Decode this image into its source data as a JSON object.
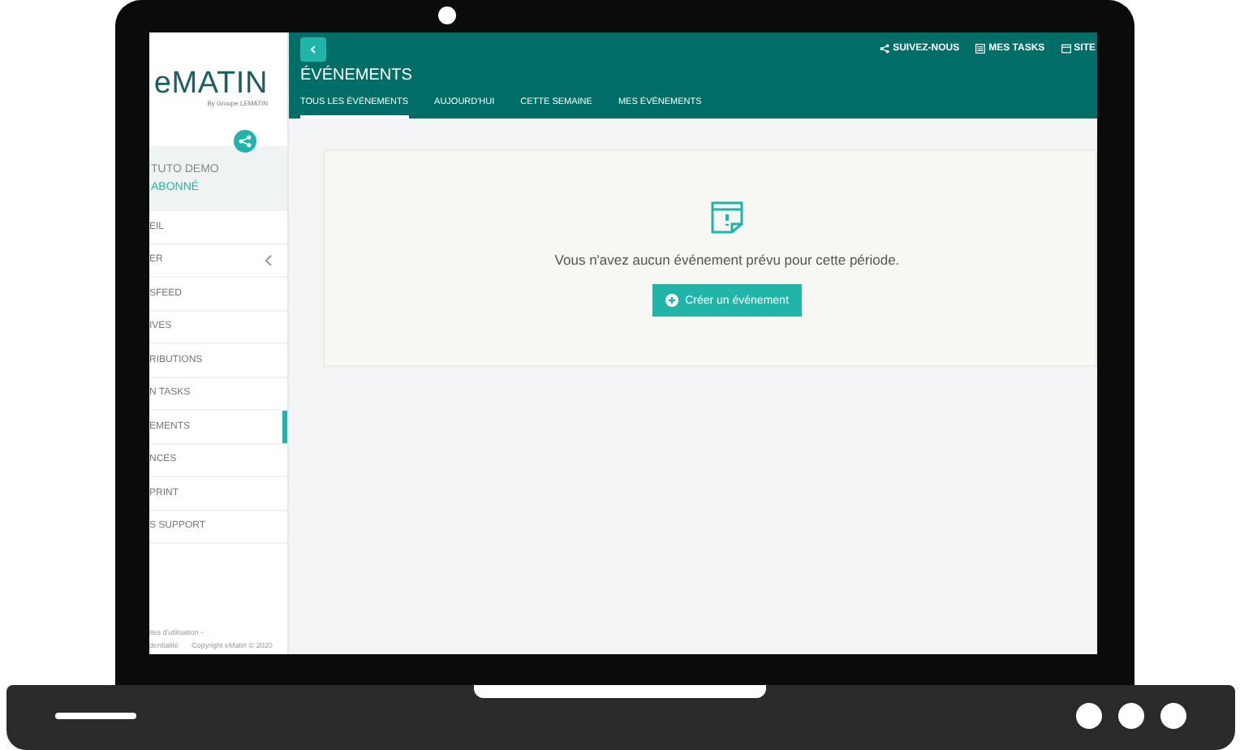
{
  "sidebar": {
    "logo": "eMATIN",
    "logo_subtitle": "By Groupe LEMATIN",
    "user_name": "TUTO DEMO",
    "user_status": "ABONNÉ",
    "items": [
      {
        "label": "EIL",
        "selected": false,
        "expandable": false
      },
      {
        "label": "ER",
        "selected": false,
        "expandable": true
      },
      {
        "label": "SFEED",
        "selected": false,
        "expandable": false
      },
      {
        "label": "IVES",
        "selected": false,
        "expandable": false
      },
      {
        "label": "RIBUTIONS",
        "selected": false,
        "expandable": false
      },
      {
        "label": "N TASKS",
        "selected": false,
        "expandable": false
      },
      {
        "label": "EMENTS",
        "selected": true,
        "expandable": false
      },
      {
        "label": "NCES",
        "selected": false,
        "expandable": false
      },
      {
        "label": "PRINT",
        "selected": false,
        "expandable": false
      },
      {
        "label": "S SUPPORT",
        "selected": false,
        "expandable": false
      }
    ],
    "footer_line_1": "ites d'utilisation -",
    "footer_line_2": "dentialité",
    "copyright": "Copyright eMatin © 2020"
  },
  "header": {
    "title": "ÉVÉNEMENTS",
    "links": [
      {
        "kind": "share",
        "label": "SUIVEZ-NOUS"
      },
      {
        "kind": "tasks",
        "label": "MES TASKS"
      },
      {
        "kind": "sites",
        "label": "SITE"
      }
    ]
  },
  "tabs": [
    {
      "label": "TOUS LES ÉVÉNEMENTS",
      "selected": true
    },
    {
      "label": "AUJOURD'HUI",
      "selected": false
    },
    {
      "label": "CETTE SEMAINE",
      "selected": false
    },
    {
      "label": "MES ÉVÉNEMENTS",
      "selected": false
    }
  ],
  "empty_state": {
    "message": "Vous n'avez aucun événement prévu pour cette période.",
    "button": "Créer un événement"
  }
}
